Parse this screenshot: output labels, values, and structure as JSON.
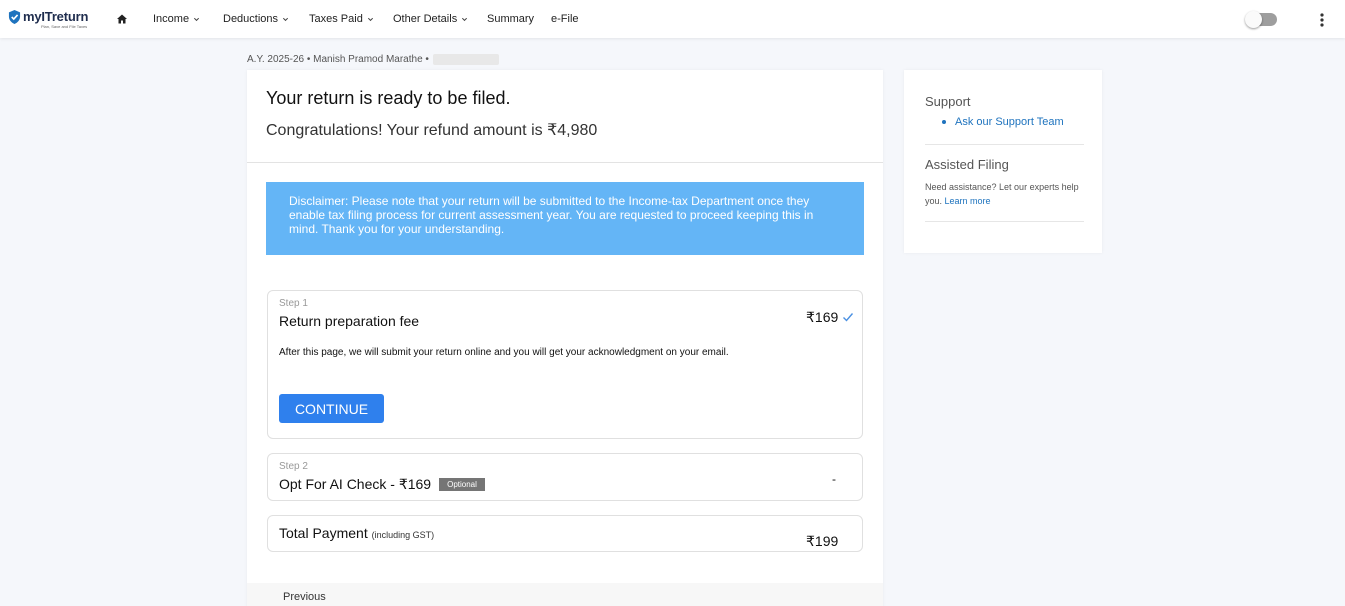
{
  "brand": {
    "name": "myITreturn",
    "tagline": "Plan, Save and File Taxes",
    "accent": "#1e73be"
  },
  "nav": {
    "home_icon": "home-icon",
    "items": [
      {
        "label": "Income",
        "dropdown": true
      },
      {
        "label": "Deductions",
        "dropdown": true
      },
      {
        "label": "Taxes Paid",
        "dropdown": true
      },
      {
        "label": "Other Details",
        "dropdown": true
      },
      {
        "label": "Summary",
        "dropdown": false
      },
      {
        "label": "e-File",
        "dropdown": false
      }
    ],
    "toggle_state": "off",
    "more_icon": "more-vertical-icon"
  },
  "breadcrumb": {
    "text": "A.Y. 2025-26 • Manish Pramod Marathe •"
  },
  "header": {
    "title": "Your return is ready to be filed.",
    "subtitle": "Congratulations! Your refund amount is ₹4,980"
  },
  "disclaimer": {
    "text": "Disclaimer: Please note that your return will be submitted to the Income-tax Department once they enable tax filing process for current assessment year. You are requested to proceed keeping this in mind. Thank you for your understanding.",
    "color": "#64b5f6"
  },
  "steps": [
    {
      "step": "Step 1",
      "title": "Return preparation fee",
      "amount": "₹169",
      "status_icon": "check-icon",
      "description": "After this page, we will submit your return online and you will get your acknowledgment on your email.",
      "button": "CONTINUE"
    },
    {
      "step": "Step 2",
      "title": "Opt For AI Check - ₹169",
      "badge": "Optional",
      "amount": "-"
    }
  ],
  "total": {
    "label": "Total Payment",
    "note": "(including GST)",
    "amount": "₹199"
  },
  "footer": {
    "previous": "Previous"
  },
  "support": {
    "title": "Support",
    "link": "Ask our Support Team",
    "assisted_title": "Assisted Filing",
    "assisted_text": "Need assistance? Let our experts help you.",
    "learn_more": "Learn more"
  }
}
